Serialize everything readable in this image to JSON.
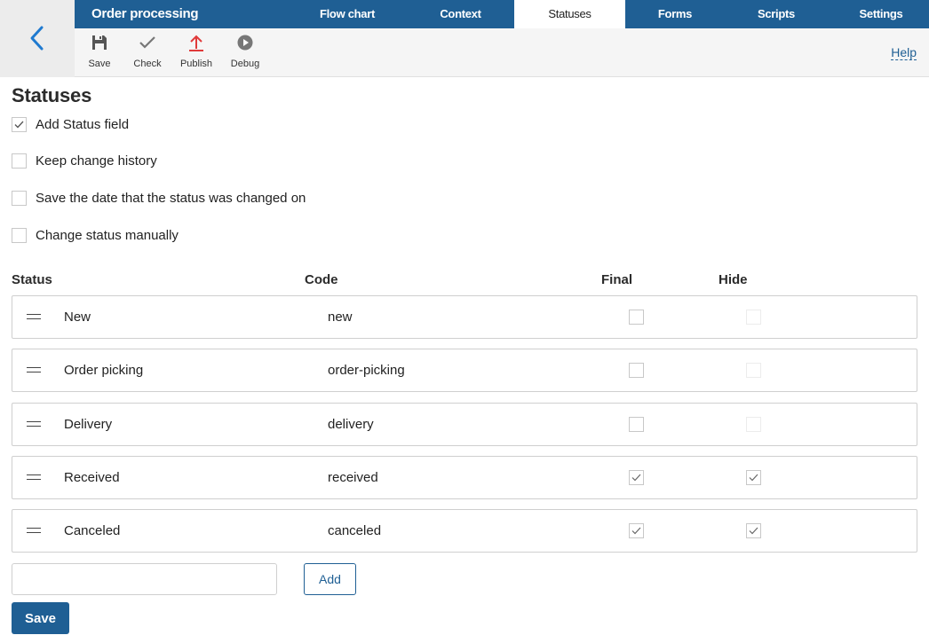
{
  "header": {
    "app_title": "Order processing",
    "tabs": [
      {
        "label": "Flow chart",
        "active": false
      },
      {
        "label": "Context",
        "active": false
      },
      {
        "label": "Statuses",
        "active": true
      },
      {
        "label": "Forms",
        "active": false
      },
      {
        "label": "Scripts",
        "active": false
      },
      {
        "label": "Settings",
        "active": false
      }
    ]
  },
  "toolbar": {
    "save_label": "Save",
    "check_label": "Check",
    "publish_label": "Publish",
    "debug_label": "Debug",
    "help_label": "Help"
  },
  "icons": {
    "back": "chevron-left-icon",
    "save": "floppy-disk-icon",
    "check": "checkmark-icon",
    "publish": "upload-arrow-icon",
    "debug": "play-circle-icon",
    "drag": "drag-handle-icon"
  },
  "colors": {
    "brand": "#1f5f94",
    "publish_icon": "#e03a3a"
  },
  "page": {
    "title": "Statuses"
  },
  "options": [
    {
      "label": "Add Status field",
      "checked": true
    },
    {
      "label": "Keep change history",
      "checked": false
    },
    {
      "label": "Save the date that the status was changed on",
      "checked": false
    },
    {
      "label": "Change status manually",
      "checked": false
    }
  ],
  "table": {
    "headers": {
      "status": "Status",
      "code": "Code",
      "final": "Final",
      "hide": "Hide"
    },
    "rows": [
      {
        "name": "New",
        "code": "new",
        "final": false,
        "hide": false
      },
      {
        "name": "Order picking",
        "code": "order-picking",
        "final": false,
        "hide": false
      },
      {
        "name": "Delivery",
        "code": "delivery",
        "final": false,
        "hide": false
      },
      {
        "name": "Received",
        "code": "received",
        "final": true,
        "hide": true
      },
      {
        "name": "Canceled",
        "code": "canceled",
        "final": true,
        "hide": true
      }
    ]
  },
  "new_status": {
    "value": "",
    "add_label": "Add"
  },
  "footer": {
    "save_label": "Save"
  }
}
